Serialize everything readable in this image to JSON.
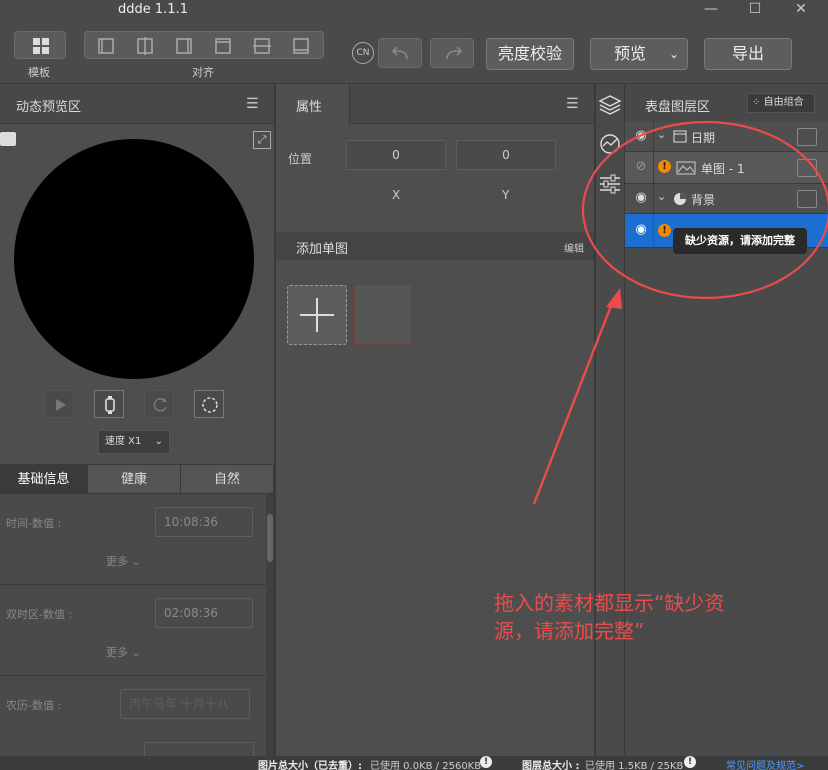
{
  "app": {
    "title": "ddde 1.1.1"
  },
  "window": {
    "minimize": "—",
    "maximize": "☐",
    "close": "✕"
  },
  "toolbar": {
    "template_label": "模板",
    "align_label": "对齐",
    "lang_badge": "CN",
    "brightness_label": "亮度校验",
    "preview_label": "预览",
    "export_label": "导出"
  },
  "preview_panel": {
    "title": "动态预览区",
    "speed_label": "速度 X1"
  },
  "tabs": [
    "基础信息",
    "健康",
    "自然"
  ],
  "info_fields": [
    {
      "label": "时间-数值 :",
      "value": "10:08:36",
      "more": "更多"
    },
    {
      "label": "双时区-数值 :",
      "value": "02:08:36",
      "more": "更多"
    },
    {
      "label": "农历-数值 :",
      "value": "丙午马年 十月十八"
    }
  ],
  "props_panel": {
    "title": "属性",
    "position_label": "位置",
    "x_value": "0",
    "y_value": "0",
    "x_label": "X",
    "y_label": "Y",
    "add_single_label": "添加单图",
    "edit_label": "编辑"
  },
  "layers_panel": {
    "title": "表盘图层区",
    "free_group_label": "自由组合",
    "rows": [
      {
        "label": "日期",
        "type": "group"
      },
      {
        "label": "单图 - 1",
        "type": "item"
      },
      {
        "label": "背景",
        "type": "group"
      },
      {
        "label": "",
        "type": "item-selected"
      }
    ],
    "tooltip": "缺少资源，请添加完整"
  },
  "annotation": {
    "text_line1": "拖入的素材都显示“缺少资",
    "text_line2": "源，请添加完整”",
    "color": "#ec4b4b"
  },
  "status": {
    "image_size_label": "图片总大小（已去重）:",
    "image_size_value": "已使用 0.0KB / 2560KB",
    "layer_size_label": "图层总大小 :",
    "layer_size_value": "已使用 1.5KB / 25KB",
    "faq_link": "常见问题及规范>"
  },
  "colors": {
    "selected_row": "#1c6fd1",
    "warning": "#f08a00",
    "link": "#4a9cff"
  }
}
